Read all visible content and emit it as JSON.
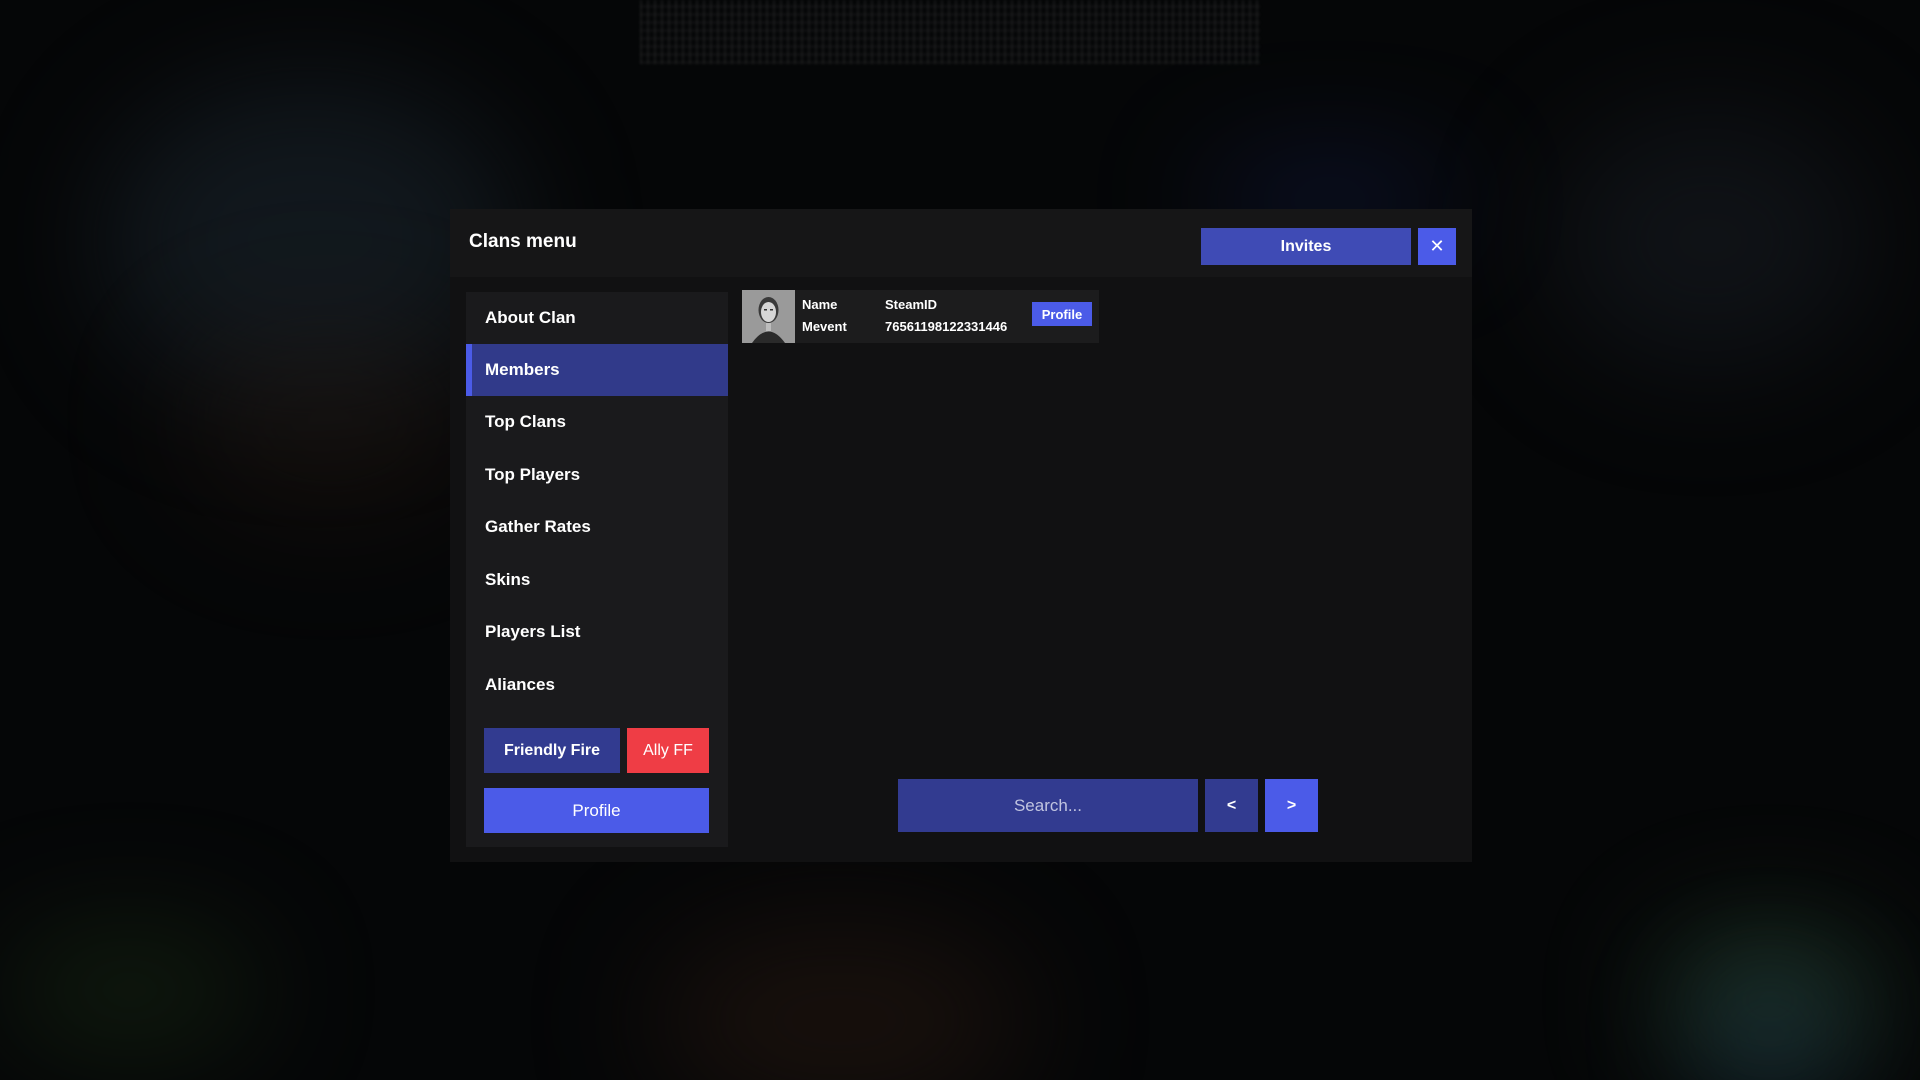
{
  "modal": {
    "title": "Clans menu",
    "invites_label": "Invites",
    "close_label": "✕"
  },
  "sidebar": {
    "items": [
      {
        "label": "About Clan"
      },
      {
        "label": "Members"
      },
      {
        "label": "Top Clans"
      },
      {
        "label": "Top Players"
      },
      {
        "label": "Gather Rates"
      },
      {
        "label": "Skins"
      },
      {
        "label": "Players List"
      },
      {
        "label": "Aliances"
      }
    ],
    "active_item": "Members",
    "friendly_fire_label": "Friendly Fire",
    "ally_ff_label": "Ally FF",
    "profile_label": "Profile"
  },
  "members": [
    {
      "name_header": "Name",
      "name": "Mevent",
      "steamid_header": "SteamID",
      "steamid": "76561198122331446",
      "profile_label": "Profile"
    }
  ],
  "search": {
    "placeholder": "Search..."
  },
  "pagination": {
    "prev_label": "<",
    "next_label": ">"
  },
  "colors": {
    "accent": "#4b5be8",
    "accent_dark": "#323b90",
    "danger": "#ef3d45",
    "panel": "#111112"
  }
}
